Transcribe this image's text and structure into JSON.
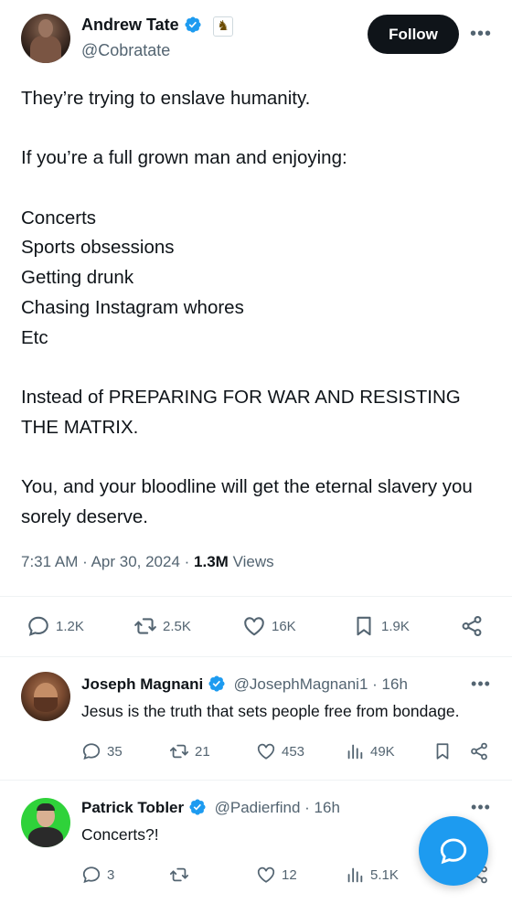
{
  "tweet": {
    "author_name": "Andrew Tate",
    "author_handle": "@Cobratate",
    "badge_icon": "chess-knight-icon",
    "follow_label": "Follow",
    "more_label": "•••",
    "lines": [
      "They’re trying to enslave humanity.",
      "",
      "If you’re a full grown man and enjoying:",
      "",
      "Concerts",
      "Sports obsessions",
      "Getting drunk",
      "Chasing Instagram whores",
      "Etc",
      "",
      "Instead of PREPARING FOR WAR AND RESISTING THE MATRIX.",
      "",
      "You, and your bloodline will get the eternal slavery you sorely deserve."
    ],
    "time": "7:31 AM",
    "date": "Apr 30, 2024",
    "views_count": "1.3M",
    "views_label": "Views",
    "actions": {
      "replies": "1.2K",
      "reposts": "2.5K",
      "likes": "16K",
      "bookmarks": "1.9K"
    }
  },
  "replies": [
    {
      "name": "Joseph Magnani",
      "handle": "@JosephMagnani1",
      "age": "16h",
      "text": "Jesus is the truth that sets people free from bondage.",
      "replies": "35",
      "reposts": "21",
      "likes": "453",
      "views": "49K"
    },
    {
      "name": "Patrick Tobler",
      "handle": "@Padierfind",
      "age": "16h",
      "text": "Concerts?!",
      "replies": "3",
      "reposts": "",
      "likes": "12",
      "views": "5.1K"
    }
  ],
  "colors": {
    "verified_blue": "#1d9bf0",
    "text_primary": "#0f1419",
    "text_secondary": "#536471",
    "fab_blue": "#1d9bf0"
  }
}
